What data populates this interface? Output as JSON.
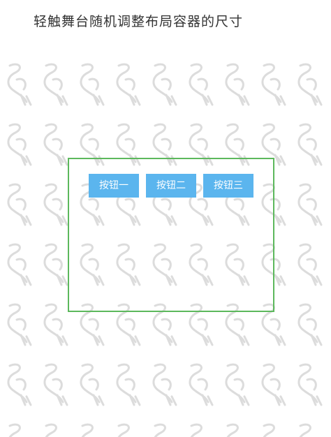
{
  "page": {
    "title": "轻触舞台随机调整布局容器的尺寸"
  },
  "container": {
    "border_color": "#5cb85c",
    "buttons": [
      {
        "label": "按钮一"
      },
      {
        "label": "按钮二"
      },
      {
        "label": "按钮三"
      }
    ],
    "button_color": "#5bb5ee"
  },
  "background": {
    "pattern_icon": "crane-watermark-icon"
  }
}
